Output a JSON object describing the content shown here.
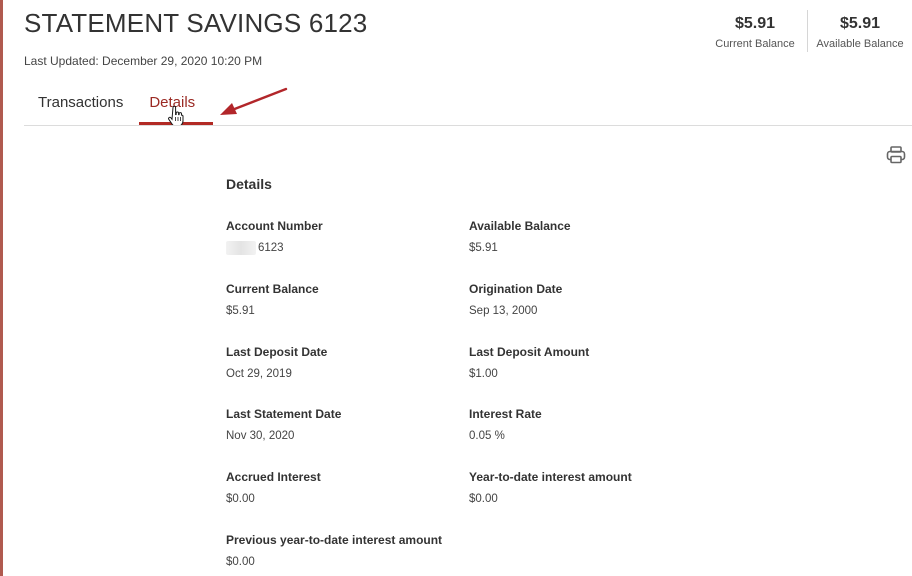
{
  "header": {
    "title": "STATEMENT SAVINGS 6123",
    "last_updated": "Last Updated: December 29, 2020 10:20 PM",
    "current_balance_amount": "$5.91",
    "current_balance_label": "Current Balance",
    "available_balance_amount": "$5.91",
    "available_balance_label": "Available Balance"
  },
  "tabs": [
    {
      "label": "Transactions",
      "active": false
    },
    {
      "label": "Details",
      "active": true
    }
  ],
  "icons": {
    "print": "printer-icon",
    "cursor": "hand-pointer-icon",
    "annotation": "red-arrow-icon"
  },
  "colors": {
    "accent": "#b22a24",
    "annotation_arrow": "#b2262a"
  },
  "details": {
    "title": "Details",
    "fields": [
      {
        "label": "Account Number",
        "value": "6123",
        "masked": true
      },
      {
        "label": "Available Balance",
        "value": "$5.91"
      },
      {
        "label": "Current Balance",
        "value": "$5.91"
      },
      {
        "label": "Origination Date",
        "value": "Sep 13, 2000"
      },
      {
        "label": "Last Deposit Date",
        "value": "Oct 29, 2019"
      },
      {
        "label": "Last Deposit Amount",
        "value": "$1.00"
      },
      {
        "label": "Last Statement Date",
        "value": "Nov 30, 2020"
      },
      {
        "label": "Interest Rate",
        "value": "0.05 %"
      },
      {
        "label": "Accrued Interest",
        "value": "$0.00"
      },
      {
        "label": "Year-to-date interest amount",
        "value": "$0.00"
      },
      {
        "label": "Previous year-to-date interest amount",
        "value": "$0.00"
      }
    ]
  }
}
